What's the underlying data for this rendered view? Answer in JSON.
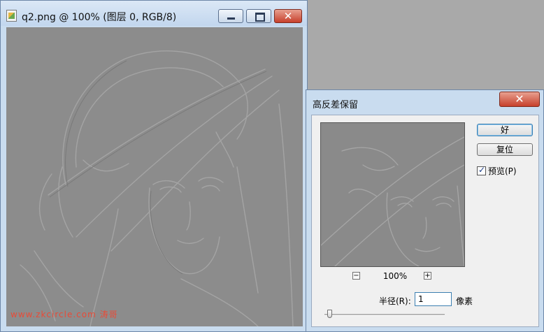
{
  "document": {
    "title": "q2.png @ 100% (图层 0, RGB/8)",
    "watermark": "www.zkcircle.com 涛哥"
  },
  "dialog": {
    "title": "高反差保留",
    "ok_label": "好",
    "reset_label": "复位",
    "preview_label": "预览(P)",
    "zoom_value": "100%",
    "zoom_out": "−",
    "zoom_in": "+",
    "radius_label": "半径(R):",
    "radius_value": "1",
    "radius_unit": "像素",
    "preview_checked": true
  },
  "window_controls": {
    "close_glyph": "✕"
  },
  "colors": {
    "titlebar": "#c9dcef",
    "close_button": "#c7402c",
    "image_gray": "#8c8c8c"
  }
}
